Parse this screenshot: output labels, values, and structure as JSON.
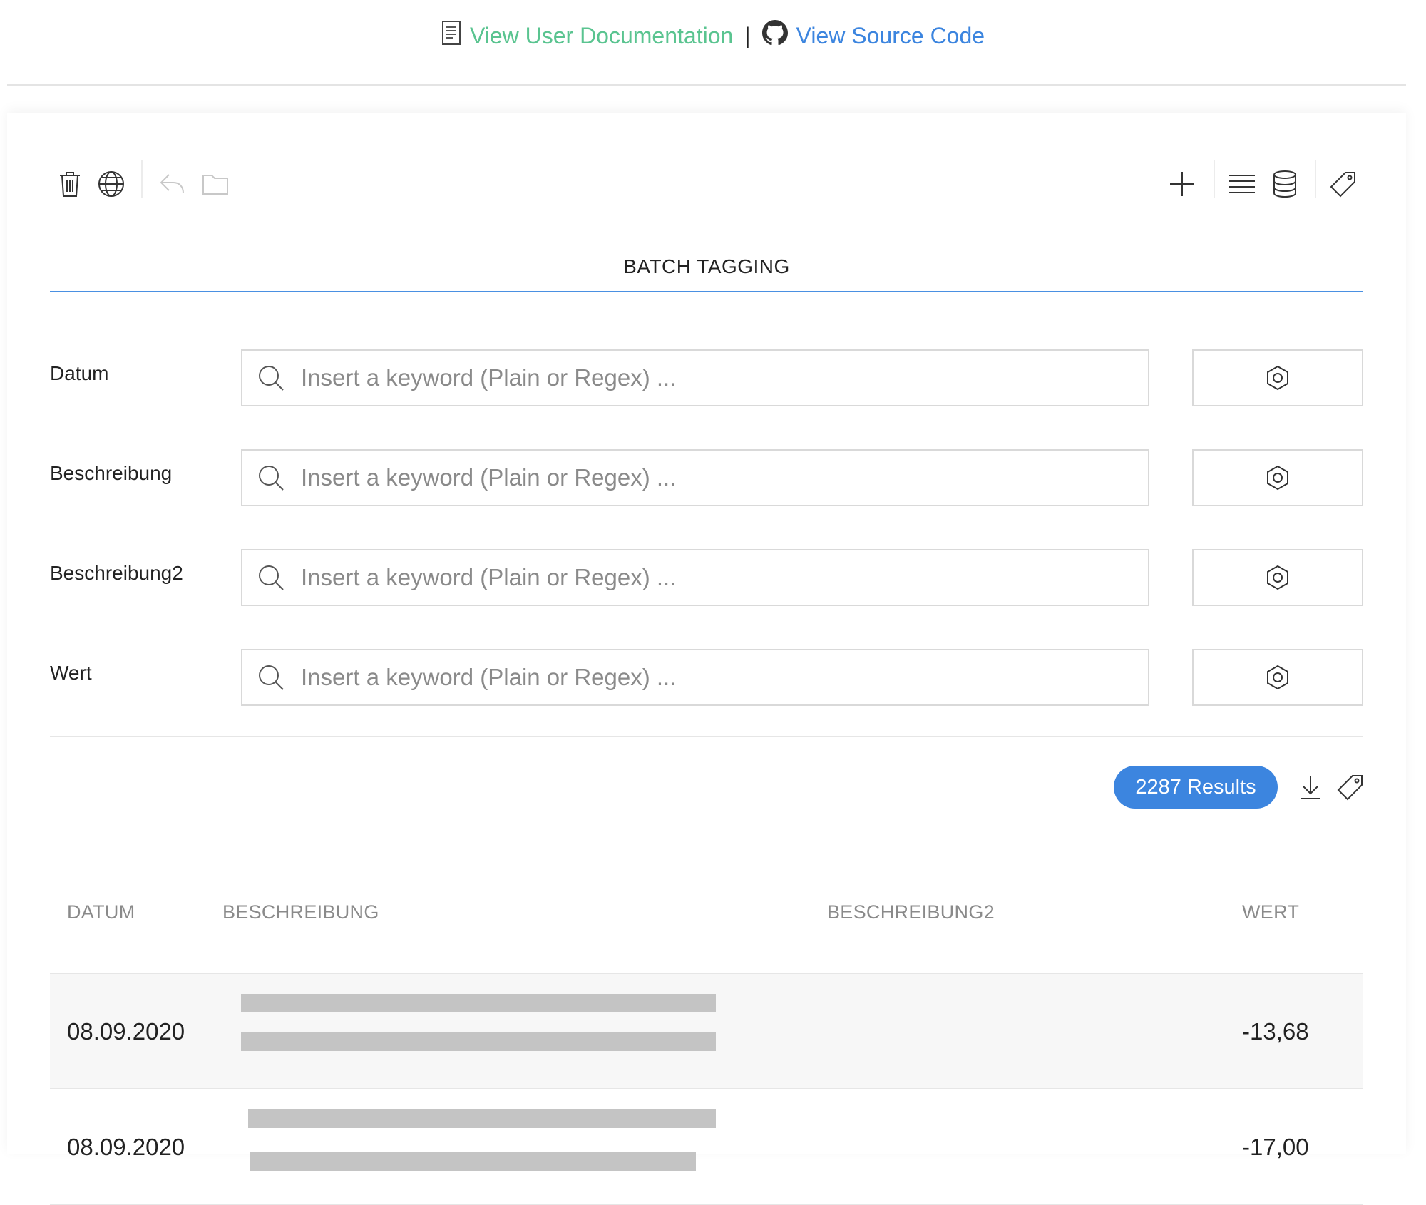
{
  "header": {
    "docs_icon": "document-icon",
    "docs_link": "View User Documentation",
    "separator": "|",
    "source_icon": "github-icon",
    "source_link": "View Source Code",
    "docs_color": "#5ac490",
    "source_color": "#3c85df"
  },
  "toolbar": {
    "left_icons": [
      "trash-icon",
      "globe-icon",
      "undo-icon",
      "folder-icon"
    ],
    "right_icons": [
      "plus-icon",
      "list-icon",
      "database-icon",
      "tag-icon"
    ]
  },
  "tab": {
    "label": "BATCH TAGGING",
    "accent": "#4a90e2"
  },
  "filters": [
    {
      "label": "Datum",
      "placeholder": "Insert a keyword (Plain or Regex) ...",
      "value": ""
    },
    {
      "label": "Beschreibung",
      "placeholder": "Insert a keyword (Plain or Regex) ...",
      "value": ""
    },
    {
      "label": "Beschreibung2",
      "placeholder": "Insert a keyword (Plain or Regex) ...",
      "value": ""
    },
    {
      "label": "Wert",
      "placeholder": "Insert a keyword (Plain or Regex) ...",
      "value": ""
    }
  ],
  "results": {
    "label": "2287 Results",
    "badge_color": "#3c85df"
  },
  "table": {
    "columns": [
      "DATUM",
      "BESCHREIBUNG",
      "BESCHREIBUNG2",
      "WERT"
    ],
    "rows": [
      {
        "datum": "08.09.2020",
        "beschreibung": "[redacted]",
        "beschreibung2": "",
        "wert": "-13,68"
      },
      {
        "datum": "08.09.2020",
        "beschreibung": "[redacted]",
        "beschreibung2": "",
        "wert": "-17,00"
      }
    ]
  }
}
